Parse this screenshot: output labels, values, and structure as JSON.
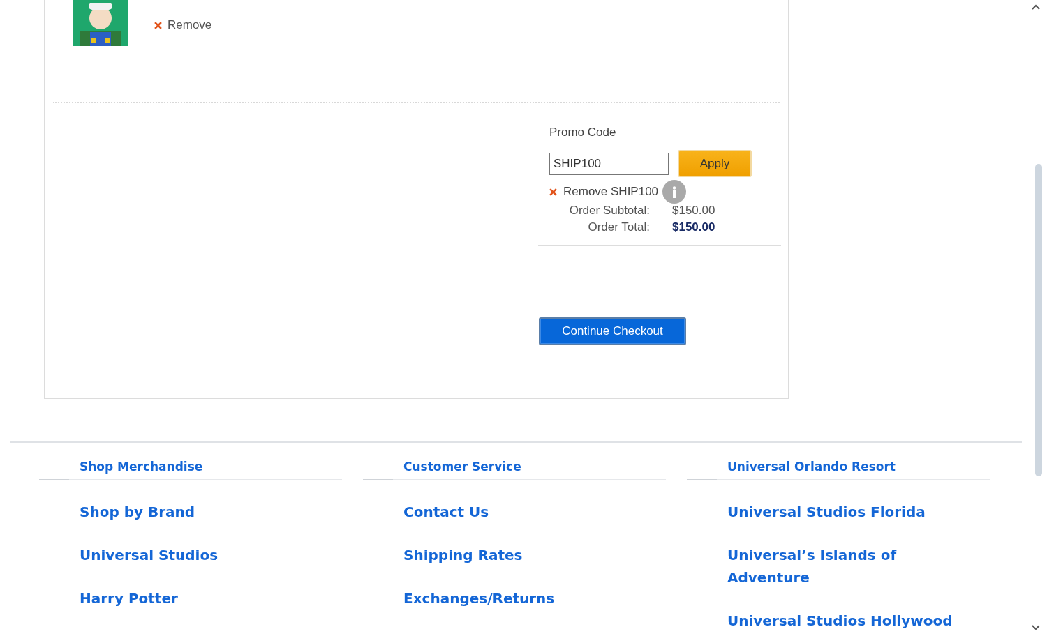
{
  "cart_item": {
    "remove_label": "Remove"
  },
  "promo": {
    "label": "Promo Code",
    "value": "SHIP100",
    "apply_button": "Apply",
    "remove_label": "Remove SHIP100"
  },
  "totals": [
    {
      "label": "Order Subtotal:",
      "value": "$150.00",
      "emphasis": false
    },
    {
      "label": "Order Total:",
      "value": "$150.00",
      "emphasis": true
    }
  ],
  "checkout_button": "Continue Checkout",
  "footer": {
    "columns": [
      {
        "heading": "Shop Merchandise",
        "links": [
          "Shop by Brand",
          "Universal Studios",
          "Harry Potter"
        ]
      },
      {
        "heading": "Customer Service",
        "links": [
          "Contact Us",
          "Shipping Rates",
          "Exchanges/Returns"
        ]
      },
      {
        "heading": "Universal Orlando Resort",
        "links": [
          "Universal Studios Florida",
          "Universal’s Islands of Adventure",
          "Universal Studios Hollywood"
        ]
      }
    ]
  }
}
